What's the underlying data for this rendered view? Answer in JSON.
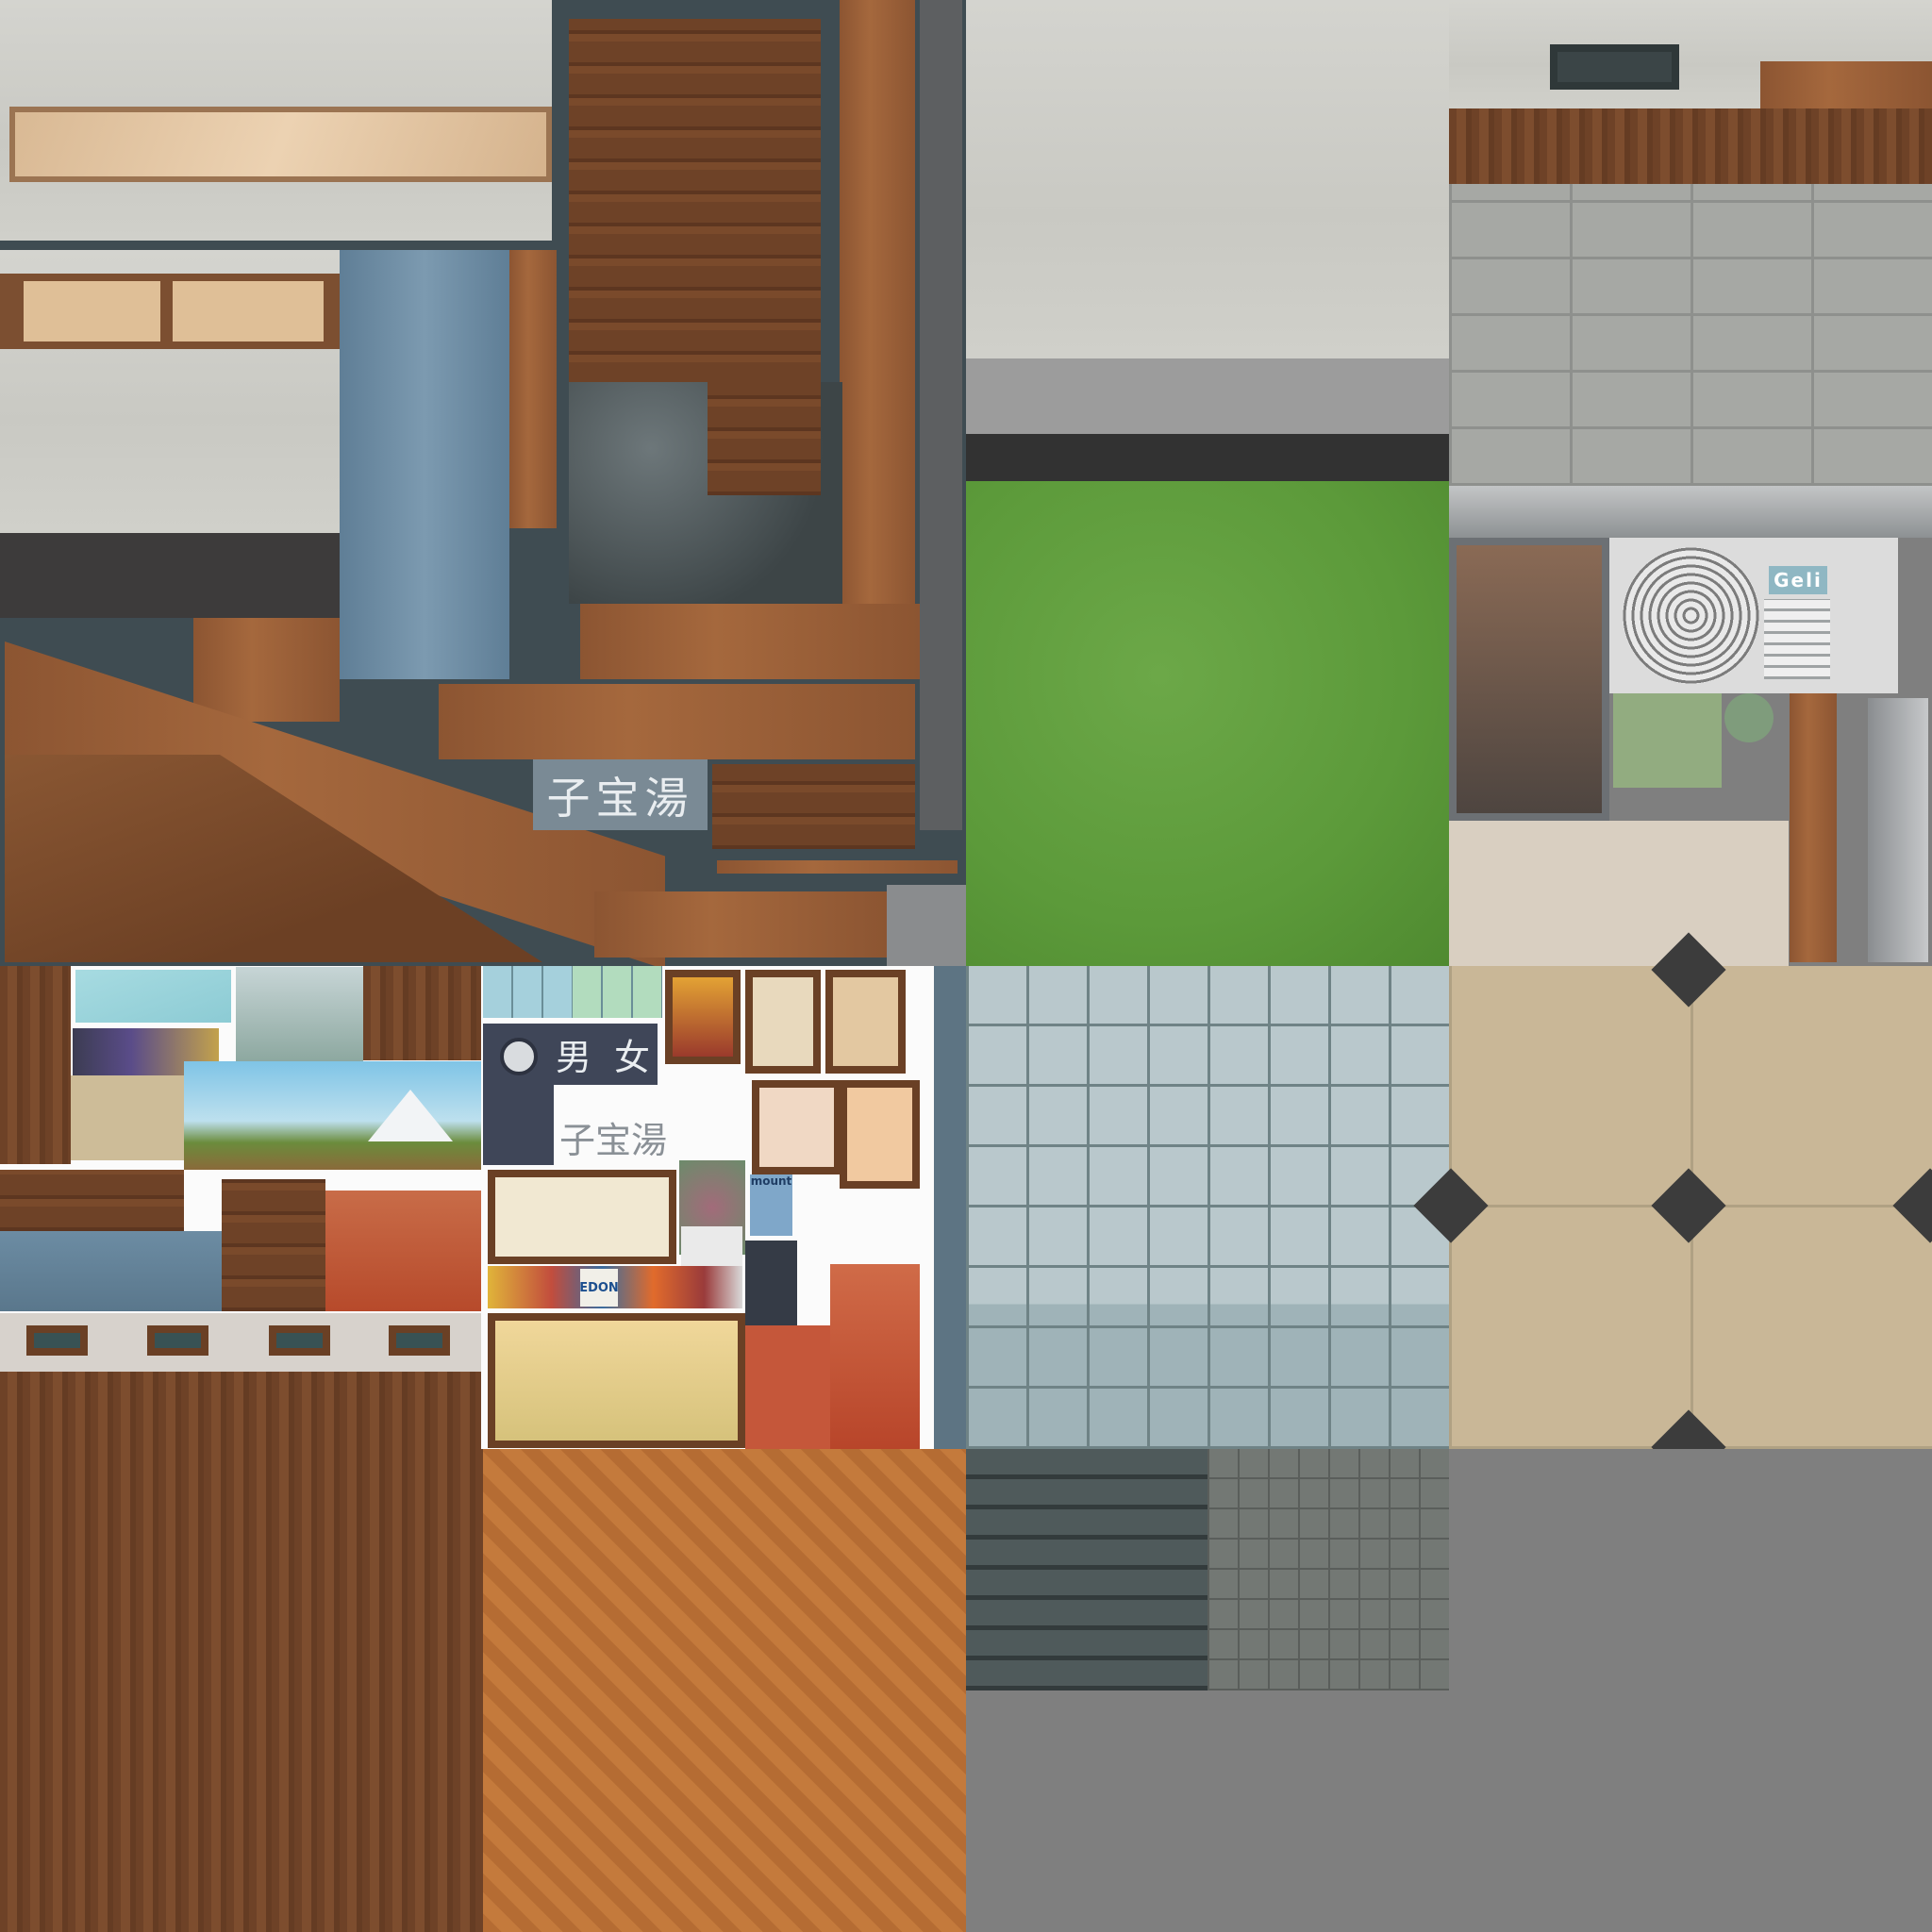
{
  "texts": {
    "sign_bath_name": "子宝湯",
    "sign_men_women": "男 女",
    "sign_bath_name_white": "子宝湯",
    "ac_brand": "Geli",
    "poster_mount": "mount",
    "poster_edon": "EDON"
  },
  "colors": {
    "grass": "#5c9a3a",
    "wood": "#7a4a2b",
    "plaster": "#cfcfca",
    "atlas_bg": "#7f7f7f",
    "tile_light": "#b9c8cc",
    "tile_beige": "#c9b797",
    "roof_tile": "#4f5a5b",
    "floor_orange": "#c47a3c"
  }
}
